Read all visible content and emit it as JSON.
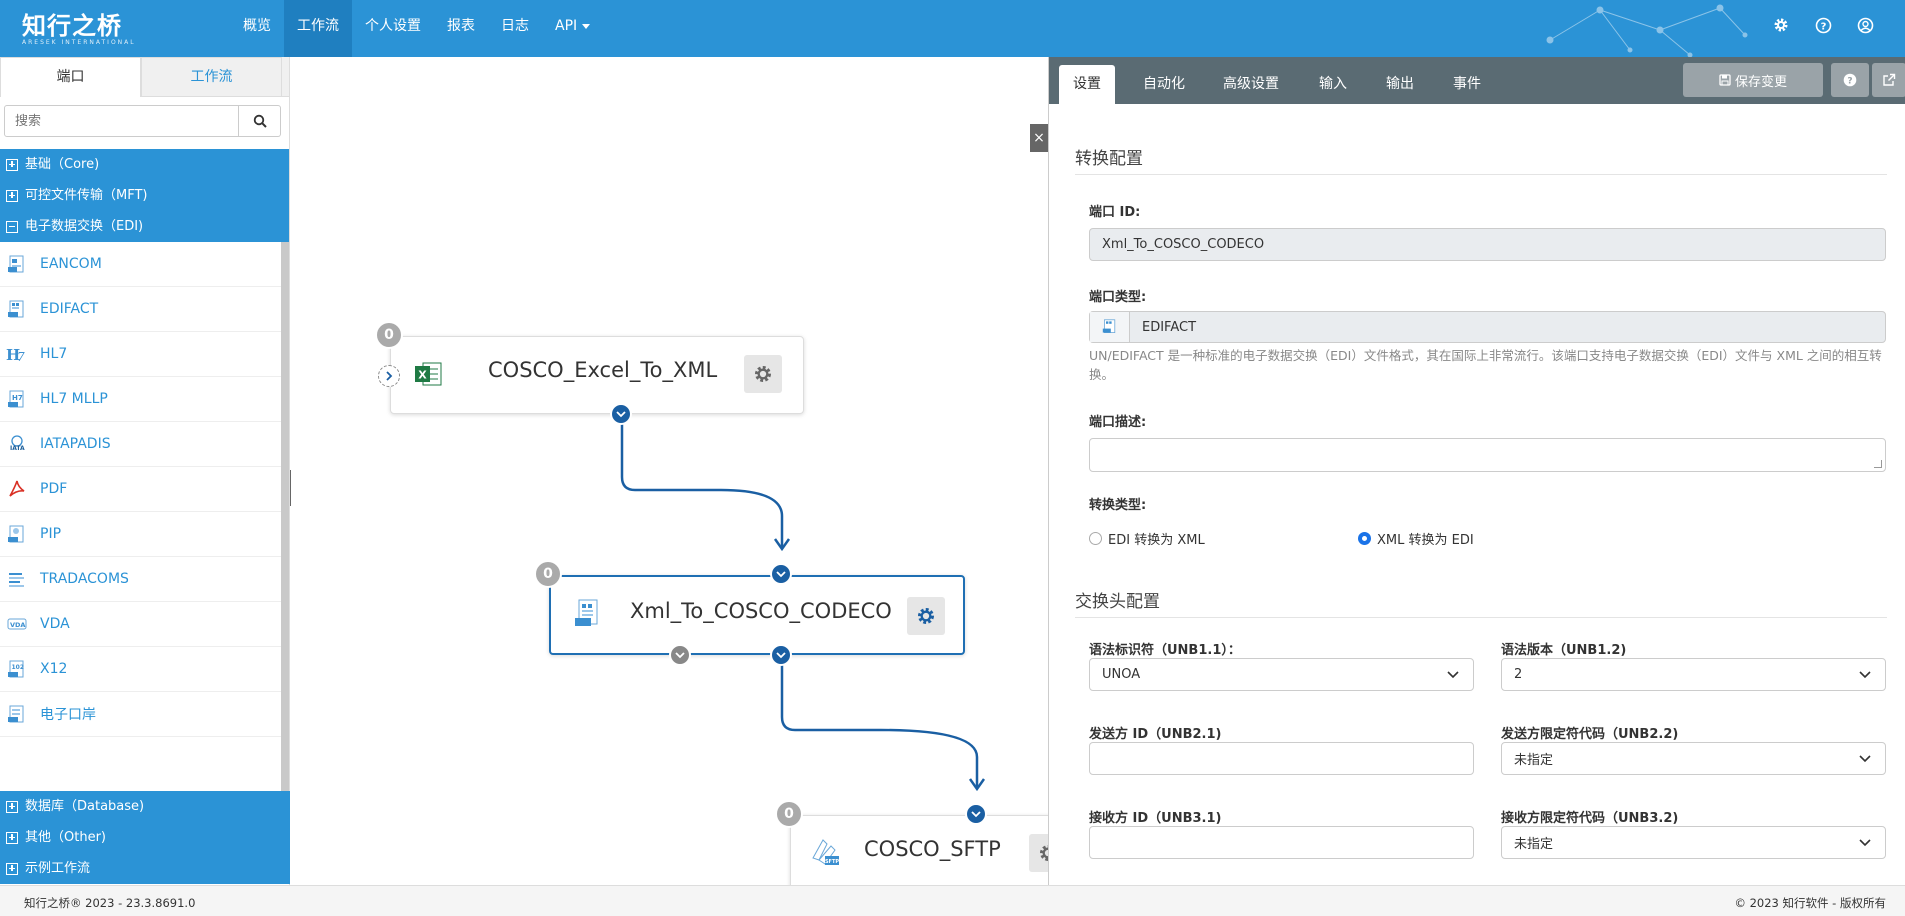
{
  "brand": {
    "name": "知行之桥",
    "subtitle": "ARESEK INTERNATIONAL"
  },
  "nav": {
    "items": [
      {
        "label": "概览"
      },
      {
        "label": "工作流",
        "active": true
      },
      {
        "label": "个人设置"
      },
      {
        "label": "报表"
      },
      {
        "label": "日志"
      },
      {
        "label": "API",
        "dropdown": true
      }
    ],
    "icons": [
      "gear-icon",
      "help-icon",
      "user-icon"
    ]
  },
  "sidebar": {
    "tabs": [
      {
        "label": "端口",
        "active": true
      },
      {
        "label": "工作流"
      }
    ],
    "search": {
      "placeholder": "搜索"
    },
    "categories_top": [
      {
        "label": "基础（Core)",
        "expanded": false
      },
      {
        "label": "可控文件传输（MFT)",
        "expanded": false
      },
      {
        "label": "电子数据交换（EDI)",
        "expanded": true
      }
    ],
    "items": [
      {
        "label": "EANCOM",
        "icon": "eancom-icon"
      },
      {
        "label": "EDIFACT",
        "icon": "edifact-icon"
      },
      {
        "label": "HL7",
        "icon": "hl7-icon"
      },
      {
        "label": "HL7 MLLP",
        "icon": "hl7-mllp-icon"
      },
      {
        "label": "IATAPADIS",
        "icon": "iata-icon"
      },
      {
        "label": "PDF",
        "icon": "pdf-icon"
      },
      {
        "label": "PIP",
        "icon": "pip-icon"
      },
      {
        "label": "TRADACOMS",
        "icon": "tradacoms-icon"
      },
      {
        "label": "VDA",
        "icon": "vda-icon"
      },
      {
        "label": "X12",
        "icon": "x12-icon"
      },
      {
        "label": "电子口岸",
        "icon": "eport-icon"
      }
    ],
    "categories_bottom": [
      {
        "label": "数据库（Database)",
        "expanded": false
      },
      {
        "label": "其他（Other)",
        "expanded": false
      },
      {
        "label": "示例工作流",
        "expanded": false
      }
    ]
  },
  "canvas": {
    "nodes": [
      {
        "title": "COSCO_Excel_To_XML",
        "count": "0",
        "icon": "excel-icon"
      },
      {
        "title": "Xml_To_COSCO_CODECO",
        "count": "0",
        "icon": "edifact-icon",
        "selected": true
      },
      {
        "title": "COSCO_SFTP",
        "count": "0",
        "icon": "sftp-icon"
      }
    ]
  },
  "panel": {
    "tabs": [
      {
        "label": "设置",
        "active": true
      },
      {
        "label": "自动化"
      },
      {
        "label": "高级设置"
      },
      {
        "label": "输入"
      },
      {
        "label": "输出"
      },
      {
        "label": "事件"
      }
    ],
    "save_label": "保存变更",
    "conversion": {
      "title": "转换配置",
      "port_id_label": "端口 ID:",
      "port_id_value": "Xml_To_COSCO_CODECO",
      "port_type_label": "端口类型:",
      "port_type_value": "EDIFACT",
      "help_text": "UN/EDIFACT 是一种标准的电子数据交换（EDI）文件格式，其在国际上非常流行。该端口支持电子数据交换（EDI）文件与 XML 之间的相互转换。",
      "desc_label": "端口描述:",
      "desc_value": "",
      "type_label": "转换类型:",
      "options": [
        {
          "label": "EDI 转换为 XML",
          "checked": false
        },
        {
          "label": "XML 转换为 EDI",
          "checked": true
        }
      ]
    },
    "header": {
      "title": "交换头配置",
      "syntax_id_label": "语法标识符（UNB1.1）：",
      "syntax_id_value": "UNOA",
      "syntax_ver_label": "语法版本（UNB1.2)",
      "syntax_ver_value": "2",
      "sender_id_label": "发送方 ID（UNB2.1)",
      "sender_id_value": "",
      "sender_qual_label": "发送方限定符代码（UNB2.2)",
      "sender_qual_value": "未指定",
      "receiver_id_label": "接收方 ID（UNB3.1)",
      "receiver_id_value": "",
      "receiver_qual_label": "接收方限定符代码（UNB3.2)",
      "receiver_qual_value": "未指定"
    }
  },
  "footer": {
    "left": "知行之桥® 2023 - 23.3.8691.0",
    "right": "© 2023 知行软件 - 版权所有"
  }
}
